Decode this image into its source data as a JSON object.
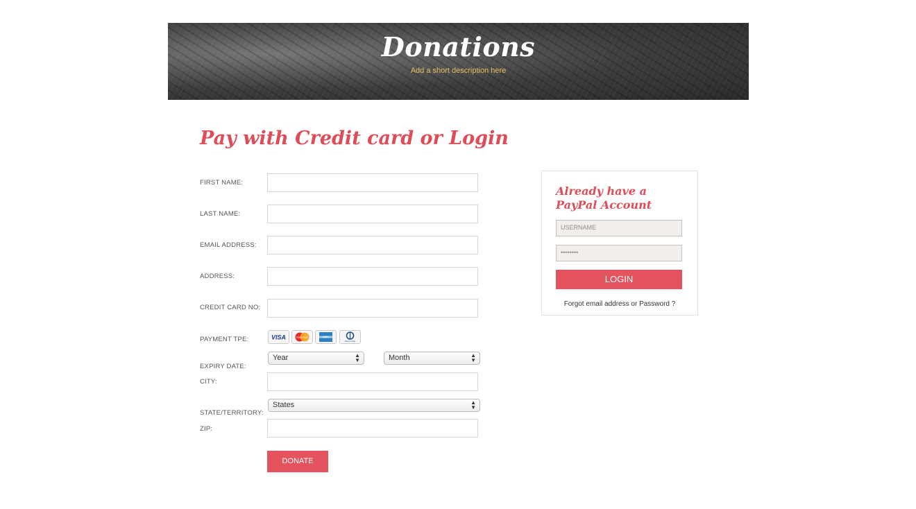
{
  "banner": {
    "title": "Donations",
    "subtitle": "Add a short description here"
  },
  "form": {
    "heading": "Pay with Credit card or Login",
    "labels": {
      "first_name": "FIRST NAME:",
      "last_name": "LAST NAME:",
      "email": "EMAIL ADDRESS:",
      "address": "ADDRESS:",
      "credit_card": "CREDIT CARD NO:",
      "payment_type": "PAYMENT TPE:",
      "expiry": "EXPIRY DATE:",
      "city": "CITY:",
      "state": "STATE/TERRITORY:",
      "zip": "ZIP:"
    },
    "values": {
      "first_name": "",
      "last_name": "",
      "email": "",
      "address": "",
      "credit_card": "",
      "city": "",
      "zip": ""
    },
    "payment_cards": [
      {
        "name": "visa-icon",
        "text": "VISA"
      },
      {
        "name": "mastercard-icon",
        "text": "MasterCard"
      },
      {
        "name": "amex-icon",
        "text": "AMEX"
      },
      {
        "name": "diners-club-icon",
        "text": "Diners Club"
      }
    ],
    "expiry_year": "Year",
    "expiry_month": "Month",
    "state_select": "States",
    "donate_label": "DONATE"
  },
  "paypal": {
    "title": "Already have a PayPal Account",
    "username_placeholder": "USERNAME",
    "password_value": "••••••••",
    "login_label": "LOGIN",
    "forgot_text": "Forgot email address or Password ?"
  },
  "colors": {
    "accent": "#e5545e",
    "heading": "#de4c57",
    "banner_subtitle": "#e3c066"
  }
}
